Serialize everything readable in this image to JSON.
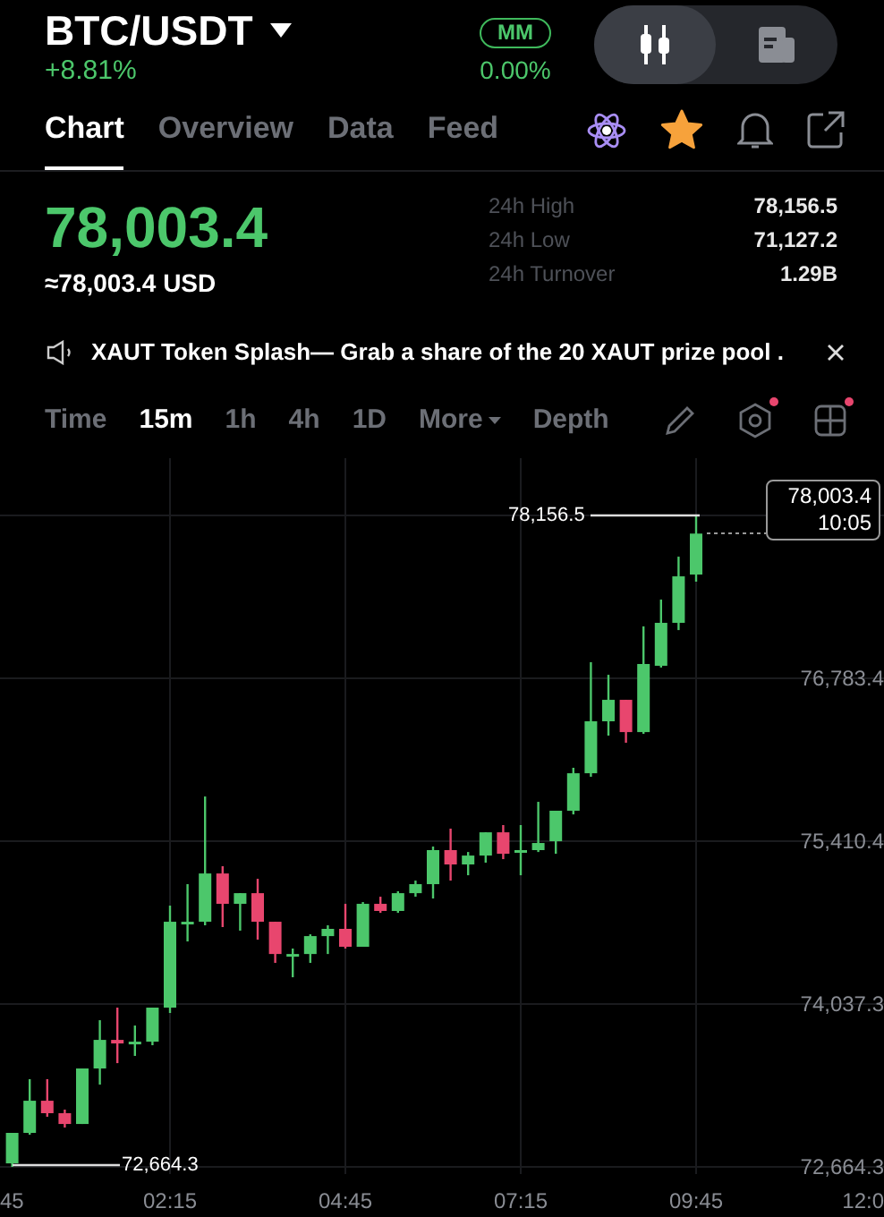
{
  "header": {
    "pair": "BTC/USDT",
    "change": "+8.81%",
    "mm_badge": "MM",
    "mm_value": "0.00%",
    "view_toggle": [
      {
        "kind": "candles",
        "selected": true
      },
      {
        "kind": "info",
        "selected": false
      }
    ]
  },
  "tabs": [
    {
      "label": "Chart",
      "selected": true
    },
    {
      "label": "Overview",
      "selected": false
    },
    {
      "label": "Data",
      "selected": false
    },
    {
      "label": "Feed",
      "selected": false
    }
  ],
  "favorite": {
    "starred": true
  },
  "price": {
    "last": "78,003.4",
    "fiat": "≈78,003.4 USD"
  },
  "stats": [
    {
      "label": "24h High",
      "value": "78,156.5"
    },
    {
      "label": "24h Low",
      "value": "71,127.2"
    },
    {
      "label": "24h Turnover",
      "value": "1.29B"
    }
  ],
  "announcement": {
    "text": "XAUT Token Splash— Grab a share of the 20 XAUT prize pool ."
  },
  "intervals": [
    {
      "label": "Time",
      "selected": false
    },
    {
      "label": "15m",
      "selected": true
    },
    {
      "label": "1h",
      "selected": false
    },
    {
      "label": "4h",
      "selected": false
    },
    {
      "label": "1D",
      "selected": false
    },
    {
      "label": "More",
      "selected": false,
      "dropdown": true
    },
    {
      "label": "Depth",
      "selected": false
    }
  ],
  "tools": [
    {
      "kind": "pencil",
      "badge": false
    },
    {
      "kind": "hexagon",
      "badge": true
    },
    {
      "kind": "grid",
      "badge": true
    }
  ],
  "chart": {
    "high_label": "78,156.5",
    "low_label": "72,664.3",
    "last_price": "78,003.4",
    "last_time": "10:05",
    "chart_data": {
      "type": "candlestick",
      "grid": true,
      "categories": [
        "45",
        null,
        null,
        null,
        null,
        null,
        null,
        null,
        null,
        null,
        "02:15",
        null,
        null,
        null,
        null,
        null,
        null,
        null,
        null,
        null,
        "04:45",
        null,
        null,
        null,
        null,
        null,
        null,
        null,
        null,
        null,
        "07:15",
        null,
        null,
        null,
        null,
        null,
        null,
        null,
        null,
        null,
        "09:45",
        null,
        null,
        null,
        null,
        null,
        null,
        null,
        null,
        null,
        "12:0"
      ],
      "ohlc": [
        null,
        [
          72694,
          72951,
          72664.3,
          72951
        ],
        [
          72951,
          73404,
          72936,
          73222
        ],
        [
          73222,
          73404,
          73087,
          73117
        ],
        [
          73117,
          73147,
          72996,
          73026
        ],
        [
          73026,
          73494,
          73026,
          73494
        ],
        [
          73494,
          73901,
          73358,
          73735
        ],
        [
          73735,
          74007,
          73539,
          73705
        ],
        [
          73705,
          73856,
          73600,
          73720
        ],
        [
          73720,
          74007,
          73690,
          74007
        ],
        [
          74007,
          74867,
          73962,
          74731
        ],
        [
          74716,
          75048,
          74565,
          74731
        ],
        [
          74731,
          75787,
          74701,
          75138
        ],
        [
          75138,
          75199,
          74686,
          74882
        ],
        [
          74882,
          74972,
          74656,
          74972
        ],
        [
          74972,
          75093,
          74580,
          74731
        ],
        [
          74731,
          74731,
          74384,
          74459
        ],
        [
          74444,
          74505,
          74263,
          74459
        ],
        [
          74459,
          74625,
          74384,
          74610
        ],
        [
          74610,
          74701,
          74459,
          74671
        ],
        [
          74671,
          74882,
          74505,
          74520
        ],
        [
          74520,
          74897,
          74520,
          74882
        ],
        [
          74882,
          74942,
          74806,
          74822
        ],
        [
          74822,
          74988,
          74806,
          74972
        ],
        [
          74972,
          75078,
          74942,
          75048
        ],
        [
          75048,
          75365,
          74927,
          75335
        ],
        [
          75335,
          75516,
          75078,
          75214
        ],
        [
          75214,
          75319,
          75123,
          75289
        ],
        [
          75289,
          75485,
          75229,
          75485
        ],
        [
          75485,
          75546,
          75259,
          75304
        ],
        [
          75319,
          75546,
          75123,
          75335
        ],
        [
          75335,
          75742,
          75319,
          75395
        ],
        [
          75410,
          75667,
          75304,
          75667
        ],
        [
          75667,
          76029,
          75636,
          75983
        ],
        [
          75983,
          76919,
          75953,
          76421
        ],
        [
          76421,
          76813,
          76300,
          76602
        ],
        [
          76602,
          76602,
          76240,
          76330
        ],
        [
          76330,
          77221,
          76315,
          76904
        ],
        [
          76889,
          77447,
          76874,
          77251
        ],
        [
          77251,
          77809,
          77190,
          77643
        ],
        [
          77658,
          78156.5,
          77598,
          78003.4
        ],
        null,
        null,
        null,
        null,
        null,
        null,
        null,
        null,
        null,
        null
      ],
      "ylim": [
        72664.3,
        78156.5
      ],
      "yticks": [
        {
          "value": 76783.4,
          "label": "76,783.4"
        },
        {
          "value": 75410.4,
          "label": "75,410.4"
        },
        {
          "value": 74037.3,
          "label": "74,037.3"
        },
        {
          "value": 72664.3,
          "label": "72,664.3"
        }
      ]
    }
  }
}
